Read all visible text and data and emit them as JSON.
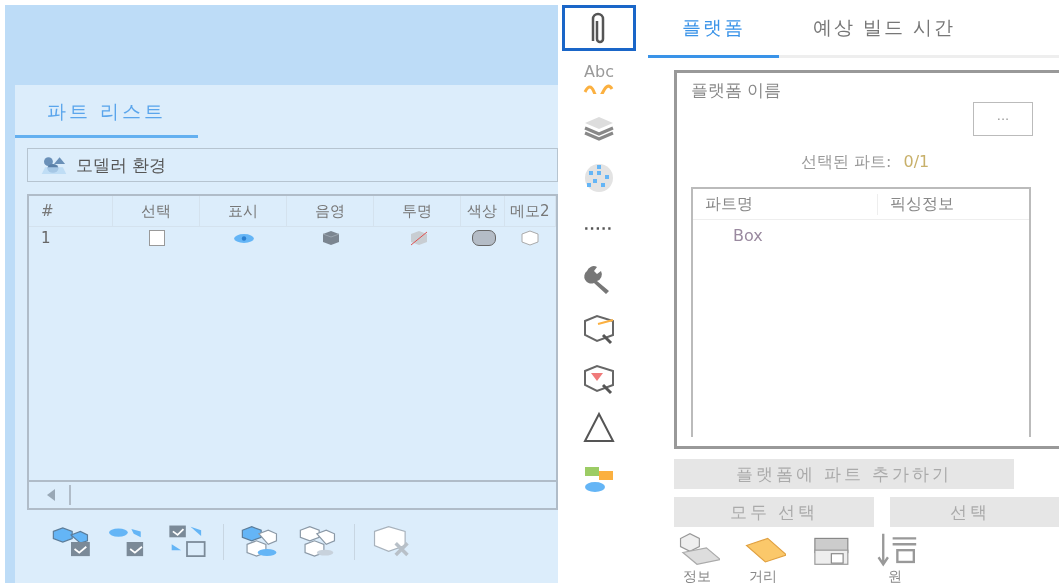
{
  "part_list_panel": {
    "tabs": [
      {
        "label": "파트 리스트",
        "selected": true
      }
    ],
    "environment_dropdown": {
      "value": "모델러 환경"
    },
    "table": {
      "columns": [
        "#",
        "선택",
        "표시",
        "음영",
        "투명",
        "색상",
        "메모2"
      ],
      "rows": [
        {
          "number": "1",
          "checked": false,
          "visible": true,
          "color": "#b4bcc6"
        }
      ]
    },
    "toolbar": [
      {
        "kind": "select-all"
      },
      {
        "kind": "show-select"
      },
      {
        "kind": "swap"
      },
      {
        "kind": "sep"
      },
      {
        "kind": "show-all"
      },
      {
        "kind": "hide-all"
      },
      {
        "kind": "sep"
      },
      {
        "kind": "delete"
      }
    ]
  },
  "vertical_toolbar": [
    {
      "kind": "paperclip",
      "selected": true
    },
    {
      "kind": "text",
      "label": "Abc",
      "selected": false
    },
    {
      "kind": "layers",
      "selected": false
    },
    {
      "kind": "sphere",
      "selected": false
    },
    {
      "kind": "dots",
      "selected": false
    },
    {
      "kind": "wrench",
      "selected": false
    },
    {
      "kind": "box-wrench",
      "selected": false
    },
    {
      "kind": "box-red",
      "selected": false
    },
    {
      "kind": "triangle",
      "selected": false
    },
    {
      "kind": "parts",
      "selected": false
    }
  ],
  "platform_panel": {
    "tabs": [
      {
        "label": "플랫폼",
        "selected": true
      },
      {
        "label": "예상 빌드 시간",
        "selected": false
      }
    ],
    "platform_name": {
      "label": "플랫폼 이름",
      "button": "···"
    },
    "selected_parts": {
      "label": "선택된 파트:",
      "value": "0/1"
    },
    "table": {
      "columns": [
        "파트명",
        "픽싱정보"
      ],
      "rows": [
        {
          "part_name": "Box"
        }
      ]
    },
    "add_button": "플랫폼에 파트 추가하기",
    "buttons": [
      "모두 선택",
      "선택"
    ],
    "bottom_toolbar": [
      {
        "kind": "box-flat",
        "label": "정보"
      },
      {
        "kind": "plate",
        "label": "거리"
      },
      {
        "kind": "printer"
      },
      {
        "kind": "down-list",
        "label": "원"
      }
    ]
  }
}
